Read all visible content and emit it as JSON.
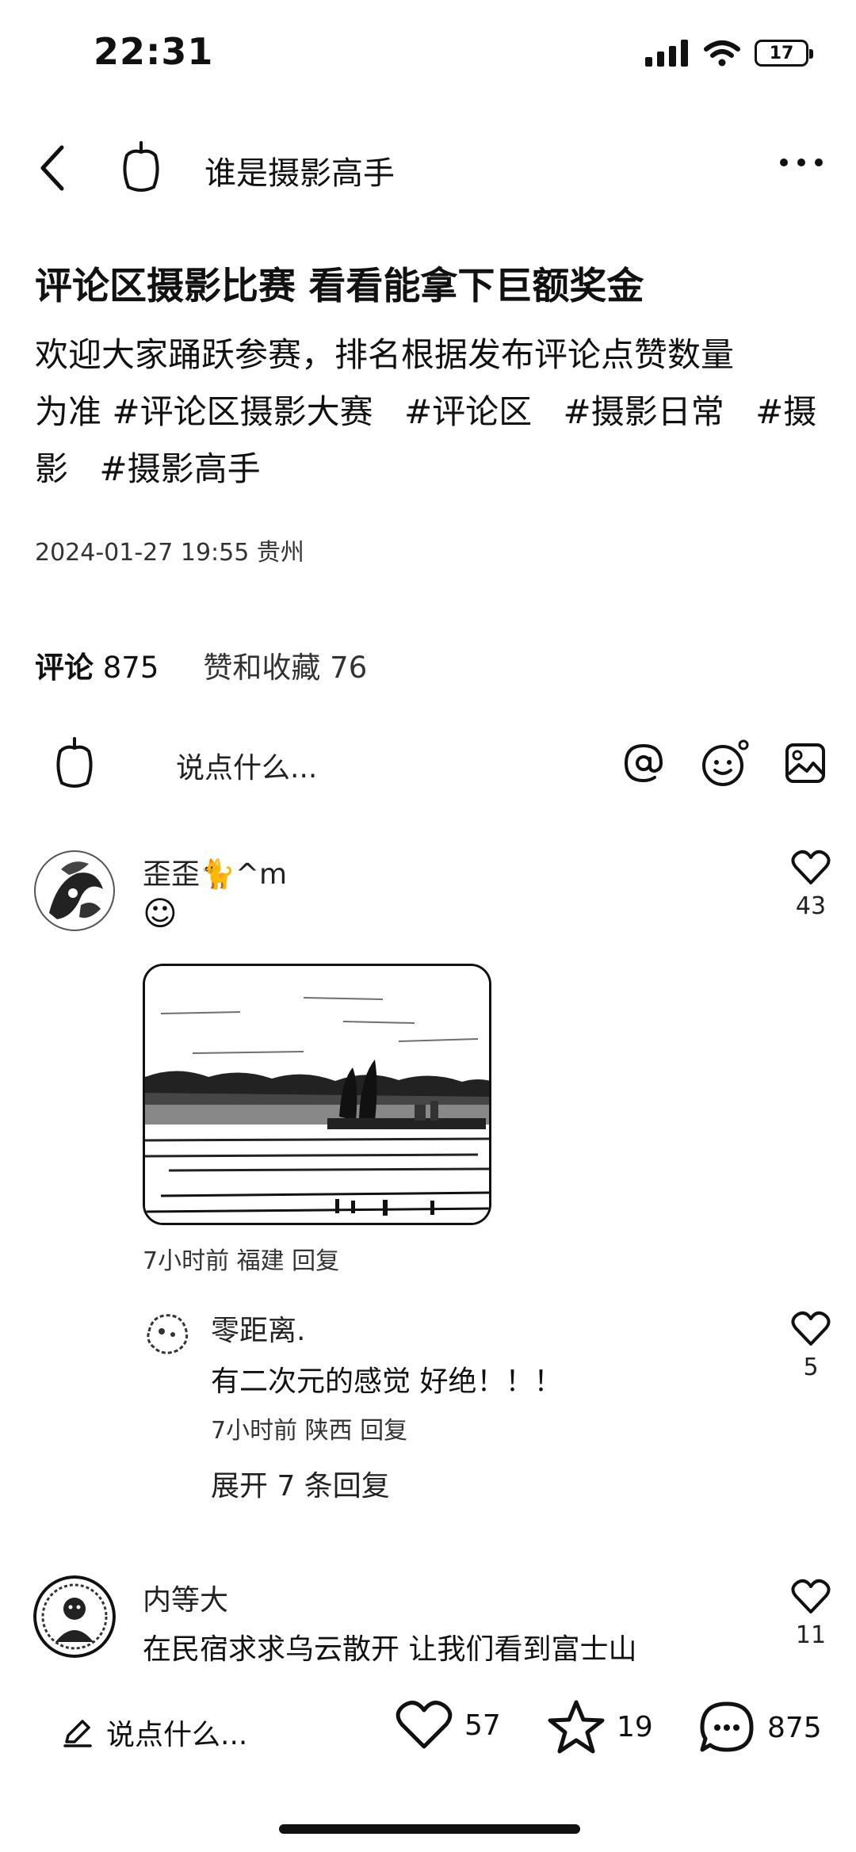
{
  "status_bar": {
    "time": "22:31",
    "battery": "17"
  },
  "header": {
    "title": "谁是摄影高手"
  },
  "post": {
    "title": "评论区摄影比赛 看看能拿下巨额奖金",
    "body_line1": "欢迎大家踊跃参赛，排名根据发布评论点赞数量",
    "body_line2_prefix": "为准",
    "tags": [
      "#评论区摄影大赛",
      "#评论区",
      "#摄影日常",
      "#摄影",
      "#摄影高手"
    ],
    "meta": "2024-01-27 19:55 贵州"
  },
  "stats": {
    "comments_label": "评论",
    "comments_count": "875",
    "likes_label": "赞和收藏",
    "likes_count": "76"
  },
  "comment_input": {
    "placeholder": "说点什么..."
  },
  "comments": [
    {
      "name": "歪歪🐈^m",
      "emoji": "☺",
      "likes": "43",
      "meta": "7小时前 福建 回复",
      "replies": [
        {
          "name": "零距离.",
          "text": "有二次元的感觉 好绝！！！",
          "likes": "5",
          "meta": "7小时前 陕西 回复"
        }
      ],
      "expand": "展开 7 条回复"
    },
    {
      "name": "内等大",
      "text": "在民宿求求乌云散开 让我们看到富士山",
      "likes": "11"
    }
  ],
  "bottom_bar": {
    "input_placeholder": "说点什么...",
    "likes": "57",
    "favorites": "19",
    "comments": "875"
  }
}
